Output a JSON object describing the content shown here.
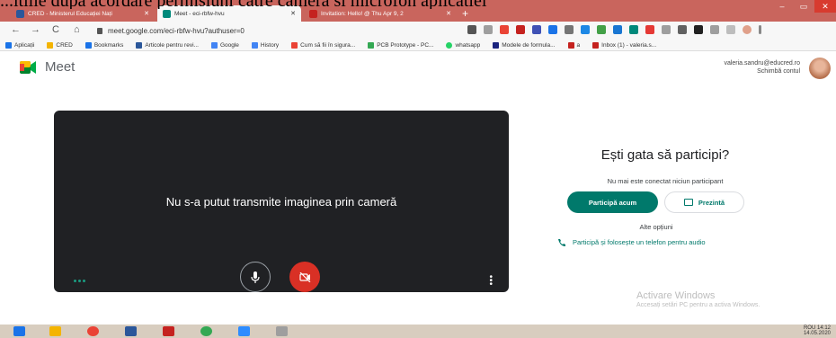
{
  "caption": "...itiile după acordare permisiuni către cameră si microfon aplicatiei",
  "tabs": [
    {
      "title": "CRED - Ministerul Educației Nați",
      "favicon_color": "#2b579a"
    },
    {
      "title": "Meet - eci-rbfw-hvu",
      "favicon_color": "#00897b"
    },
    {
      "title": "Invitation: Hello! @ Thu Apr 9, 2",
      "favicon_color": "#c5221f"
    }
  ],
  "window_controls": {
    "minimize": "–",
    "maximize": "▭",
    "close": "✕"
  },
  "toolbar": {
    "back": "←",
    "forward": "→",
    "reload": "C",
    "home": "⌂",
    "url": "meet.google.com/eci-rbfw-hvu?authuser=0"
  },
  "bookmarks": [
    {
      "label": "Aplicații",
      "color": "#1a73e8"
    },
    {
      "label": "CRED",
      "color": "#f4b400"
    },
    {
      "label": "Bookmarks",
      "color": "#1a73e8"
    },
    {
      "label": "Articole pentru revi...",
      "color": "#2b579a"
    },
    {
      "label": "Google",
      "color": "#4285f4"
    },
    {
      "label": "History",
      "color": "#4285f4"
    },
    {
      "label": "Cum să fii în sigura...",
      "color": "#ea4335"
    },
    {
      "label": "PCB Prototype - PC...",
      "color": "#34a853"
    },
    {
      "label": "whatsapp",
      "color": "#25d366"
    },
    {
      "label": "Modele de formula...",
      "color": "#1a237e"
    },
    {
      "label": "a",
      "color": "#c5221f"
    },
    {
      "label": "Inbox (1) - valeria.s...",
      "color": "#c5221f"
    }
  ],
  "meet": {
    "wordmark": "Meet",
    "account_email": "valeria.sandru@educred.ro",
    "switch_account": "Schimbă contul"
  },
  "video": {
    "message": "Nu s-a putut transmite imaginea prin cameră"
  },
  "join": {
    "title": "Ești gata să participi?",
    "status": "Nu mai este conectat niciun participant",
    "join_label": "Participă acum",
    "present_label": "Prezintă",
    "other_options": "Alte opțiuni",
    "phone_label": "Participă și folosește un telefon pentru audio"
  },
  "watermark": {
    "title": "Activare Windows",
    "subtitle": "Accesați setări PC pentru a activa Windows."
  },
  "taskbar": {
    "apps": [
      {
        "name": "start",
        "color": "#1a73e8"
      },
      {
        "name": "file-explorer",
        "color": "#f4b400"
      },
      {
        "name": "chrome",
        "color": "#ea4335"
      },
      {
        "name": "word",
        "color": "#2b579a"
      },
      {
        "name": "app-g",
        "color": "#c5221f"
      },
      {
        "name": "chrome-2",
        "color": "#34a853"
      },
      {
        "name": "zoom",
        "color": "#2d8cff"
      },
      {
        "name": "app-8",
        "color": "#9e9e9e"
      }
    ],
    "lang": "ROU",
    "time": "14:12",
    "date": "14.05.2020"
  }
}
